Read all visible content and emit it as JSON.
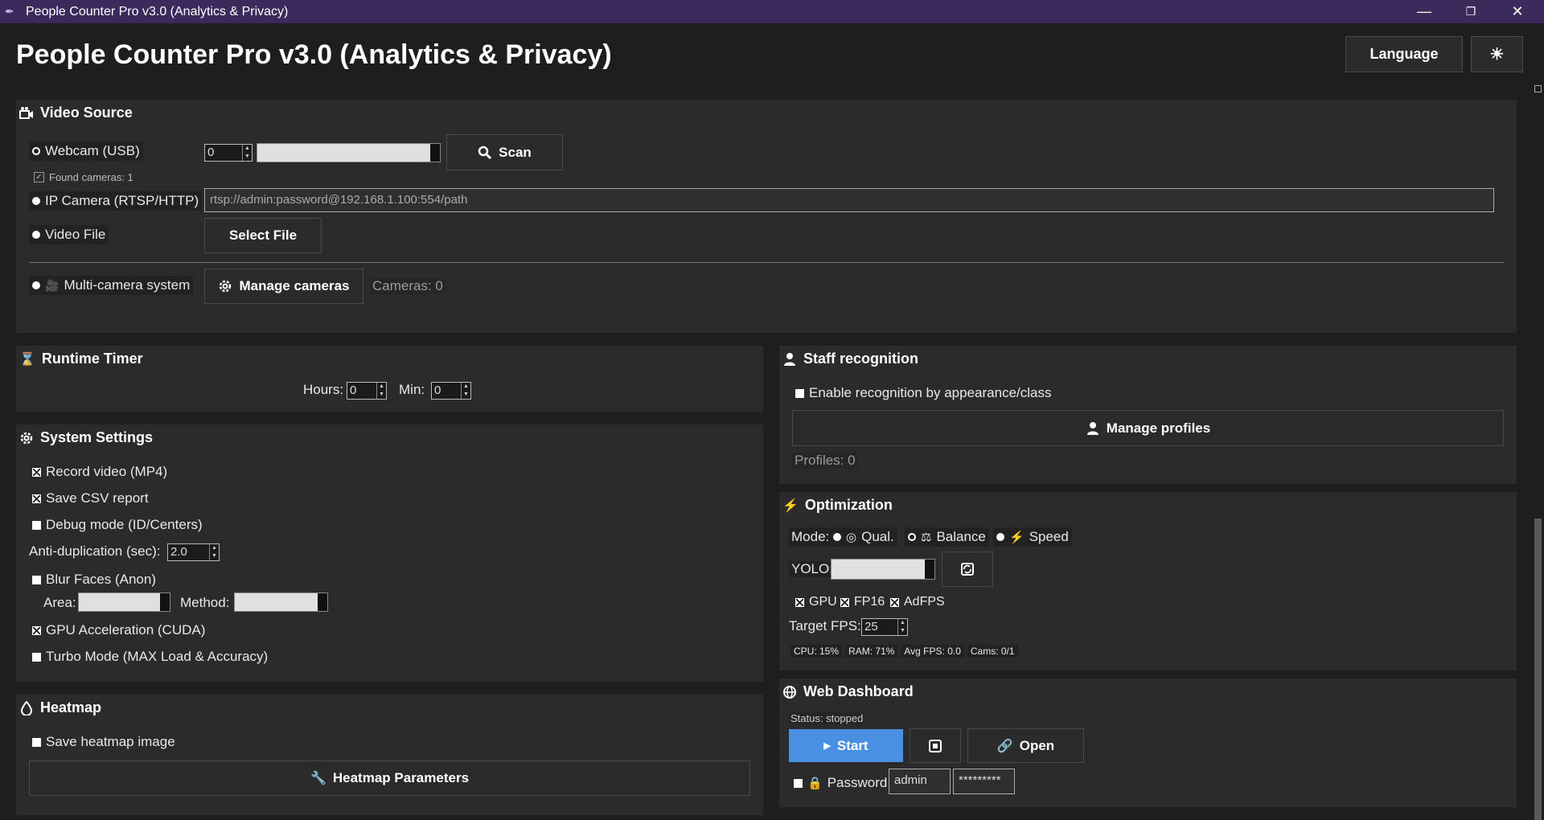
{
  "window": {
    "title": "People Counter Pro v3.0 (Analytics & Privacy)"
  },
  "header": {
    "title": "People Counter Pro v3.0 (Analytics & Privacy)",
    "language_label": "Language",
    "theme_icon": "sun-icon"
  },
  "video_source": {
    "title": "Video Source",
    "webcam_label": "Webcam (USB)",
    "webcam_index": "0",
    "scan_label": "Scan",
    "found_cameras": "Found cameras: 1",
    "ip_label": "IP Camera (RTSP/HTTP)",
    "ip_placeholder": "rtsp://admin:password@192.168.1.100:554/path",
    "file_label": "Video File",
    "select_file": "Select File",
    "multi_label": "Multi-camera system",
    "manage_cameras": "Manage cameras",
    "cameras_count": "Cameras: 0"
  },
  "runtime": {
    "title": "Runtime Timer",
    "hours_label": "Hours:",
    "hours": "0",
    "min_label": "Min:",
    "min": "0"
  },
  "system": {
    "title": "System Settings",
    "record": "Record video (MP4)",
    "csv": "Save CSV report",
    "debug": "Debug mode (ID/Centers)",
    "antidup_label": "Anti-duplication (sec):",
    "antidup": "2.0",
    "blur": "Blur Faces (Anon)",
    "area_label": "Area:",
    "method_label": "Method:",
    "gpu": "GPU Acceleration (CUDA)",
    "turbo": "Turbo Mode (MAX Load & Accuracy)"
  },
  "heatmap": {
    "title": "Heatmap",
    "save": "Save heatmap image",
    "params": "Heatmap Parameters"
  },
  "staff": {
    "title": "Staff recognition",
    "enable": "Enable recognition by appearance/class",
    "manage": "Manage profiles",
    "profiles": "Profiles: 0"
  },
  "optimization": {
    "title": "Optimization",
    "mode_label": "Mode:",
    "qual": "Qual.",
    "balance": "Balance",
    "speed": "Speed",
    "yolo_label": "YOLO:",
    "gpu": "GPU",
    "fp16": "FP16",
    "adfps": "AdFPS",
    "target_label": "Target FPS:",
    "target": "25",
    "cpu": "CPU: 15%",
    "ram": "RAM: 71%",
    "avg": "Avg FPS: 0.0",
    "cams": "Cams: 0/1"
  },
  "web": {
    "title": "Web Dashboard",
    "status": "Status: stopped",
    "start": "Start",
    "open": "Open",
    "password_label": "Password",
    "user": "admin",
    "password": "*********"
  },
  "colors": {
    "titlebar": "#3b2a5c",
    "accent": "#4a90e2",
    "panel": "#2b2b2b",
    "bg": "#1e1e1e"
  }
}
